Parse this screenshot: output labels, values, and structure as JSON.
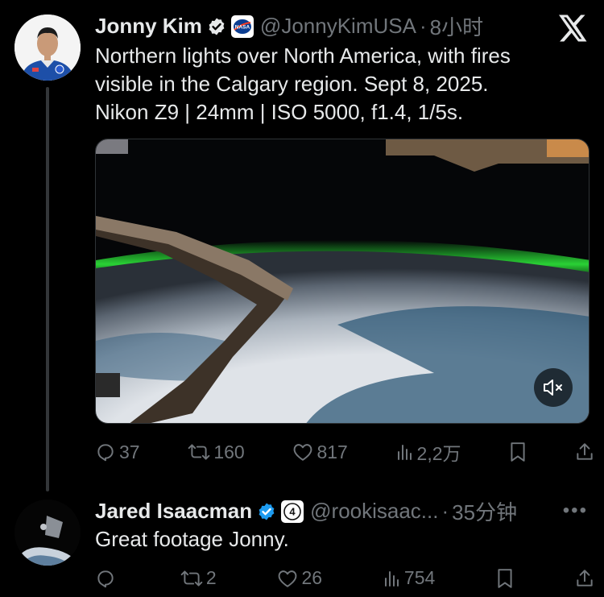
{
  "tweet": {
    "author_name": "Jonny Kim",
    "handle": "@JonnyKimUSA",
    "separator": "·",
    "time": "8小时",
    "text": "Northern lights over North America, with fires\nvisible in the Calgary region. Sept 8, 2025.\nNikon Z9 | 24mm | ISO 5000, f1.4, 1/5s.",
    "stats": {
      "replies": "37",
      "reposts": "160",
      "likes": "817",
      "views": "2,2万"
    }
  },
  "reply": {
    "author_name": "Jared Isaacman",
    "badge_number": "4",
    "handle": "@rookisaac...",
    "separator": "·",
    "time": "35分钟",
    "text": "Great footage Jonny.",
    "stats": {
      "replies": "",
      "reposts": "2",
      "likes": "26",
      "views": "754"
    }
  },
  "icons": {
    "logo": "x-logo-icon",
    "verified": "verified-badge-icon",
    "affiliate": "nasa-logo-icon",
    "reply": "reply-icon",
    "repost": "repost-icon",
    "like": "heart-icon",
    "views": "views-icon",
    "bookmark": "bookmark-icon",
    "share": "share-icon",
    "mute": "muted-speaker-icon"
  },
  "colors": {
    "background": "#000000",
    "text": "#e7e9ea",
    "secondary": "#71767b",
    "verified": "#1d9bf0",
    "aurora": "#3cf03c"
  }
}
